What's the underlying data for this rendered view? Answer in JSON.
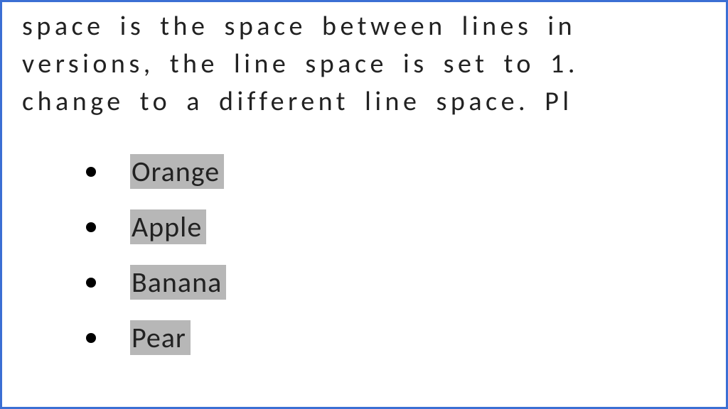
{
  "paragraph": {
    "line1": "space is the space between lines in",
    "line2": "versions, the line space is set to 1.",
    "line3": "change to a different line space. Pl"
  },
  "list": {
    "items": [
      {
        "label": "Orange"
      },
      {
        "label": "Apple"
      },
      {
        "label": "Banana"
      },
      {
        "label": "Pear"
      }
    ]
  },
  "selection_highlight_color": "#b7b7b7",
  "border_color": "#3b6fd4"
}
